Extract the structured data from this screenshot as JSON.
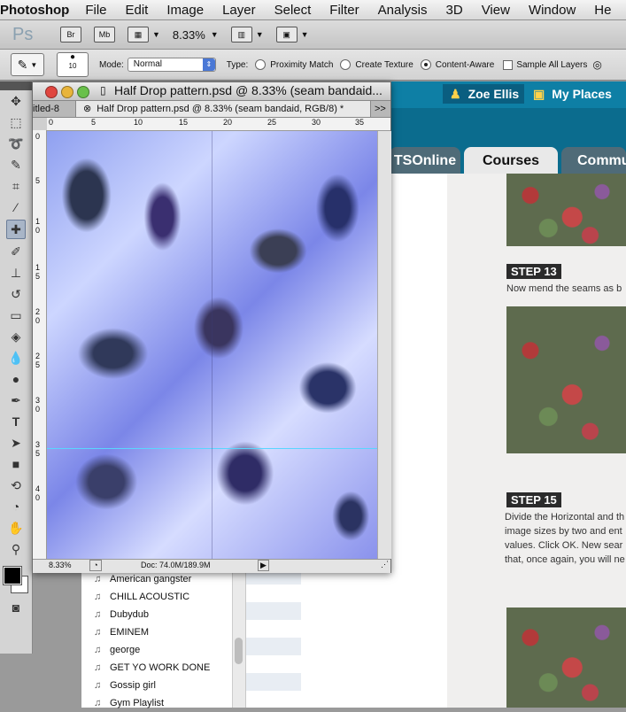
{
  "menubar": {
    "app_name": "Photoshop",
    "items": [
      "File",
      "Edit",
      "Image",
      "Layer",
      "Select",
      "Filter",
      "Analysis",
      "3D",
      "View",
      "Window",
      "He"
    ]
  },
  "appbar": {
    "logo": "Ps",
    "bridge": "Br",
    "minibridge": "Mb",
    "zoom": "8.33%"
  },
  "options": {
    "brush_size": "10",
    "mode_label": "Mode:",
    "mode_value": "Normal",
    "type_label": "Type:",
    "type_options": [
      "Proximity Match",
      "Create Texture",
      "Content-Aware"
    ],
    "selected_type": "Content-Aware",
    "sample_all_layers": "Sample All Layers"
  },
  "document": {
    "window_title": "Half Drop pattern.psd @ 8.33% (seam bandaid...",
    "tab_prev": "itled-8",
    "tab_active": "Half Drop pattern.psd @ 8.33% (seam bandaid, RGB/8) *",
    "tab_overflow": ">>",
    "ruler_h": [
      "0",
      "5",
      "10",
      "15",
      "20",
      "25",
      "30",
      "35"
    ],
    "ruler_v": [
      "0",
      "5",
      "1\n0",
      "1\n5",
      "2\n0",
      "2\n5",
      "3\n0",
      "3\n5",
      "4\n0"
    ],
    "status_zoom": "8.33%",
    "status_doc": "Doc: 74.0M/189.9M"
  },
  "website": {
    "user": "Zoe Ellis",
    "places": "My Places",
    "tab_partial": "TSOnline",
    "tab_courses": "Courses",
    "tab_community": "Commu",
    "step13_label": "STEP 13",
    "step13_text": "Now mend the seams as b",
    "step15_label": "STEP 15",
    "step15_lines": [
      "Divide the Horizontal and th",
      "image sizes by two and ent",
      "values. Click OK. New sear",
      "that, once again, you will ne"
    ]
  },
  "playlist": {
    "items": [
      "American gangster",
      "CHILL ACOUSTIC",
      "Dubydub",
      "EMINEM",
      "george",
      "GET YO WORK DONE",
      "Gossip girl",
      "Gym Playlist"
    ]
  }
}
